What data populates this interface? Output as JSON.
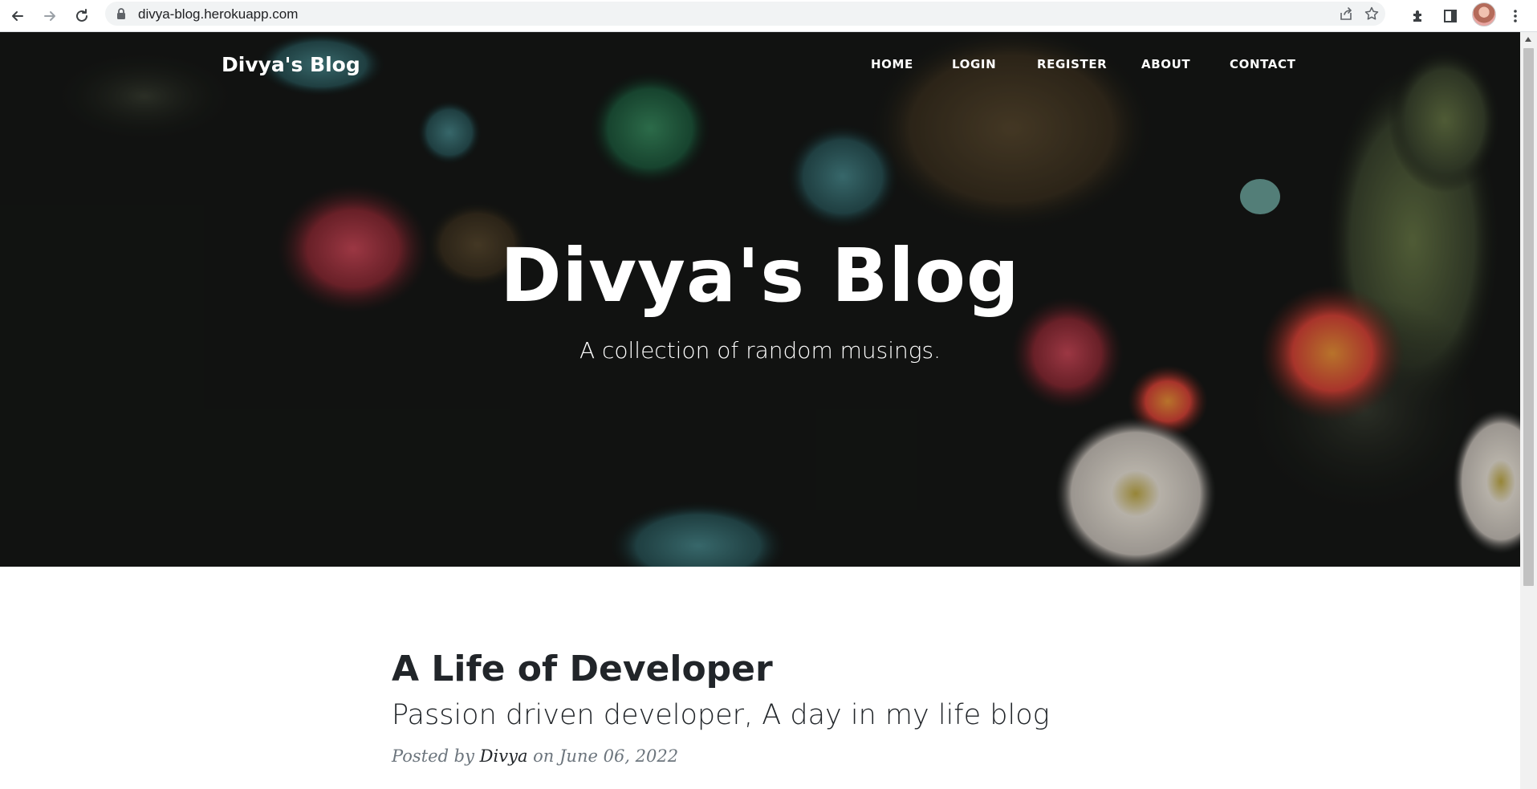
{
  "browser": {
    "url": "divya-blog.herokuapp.com",
    "icons": [
      "back-icon",
      "forward-icon",
      "reload-icon",
      "lock-icon",
      "share-icon",
      "star-icon",
      "extensions-icon",
      "side-panel-icon",
      "profile-avatar",
      "menu-icon"
    ]
  },
  "site": {
    "brand": "Divya's Blog",
    "nav": [
      {
        "label": "HOME"
      },
      {
        "label": "LOGIN"
      },
      {
        "label": "REGISTER"
      },
      {
        "label": "ABOUT"
      },
      {
        "label": "CONTACT"
      }
    ]
  },
  "hero": {
    "title": "Divya's Blog",
    "subtitle": "A collection of random musings."
  },
  "post": {
    "title": "A Life of Developer",
    "subtitle": "Passion driven developer, A day in my life blog",
    "meta_prefix": "Posted by ",
    "author": "Divya",
    "meta_on": " on ",
    "date": "June 06, 2022"
  },
  "colors": {
    "text_dark": "#212529",
    "meta_gray": "#6c757d",
    "hero_bg": "#141613"
  }
}
